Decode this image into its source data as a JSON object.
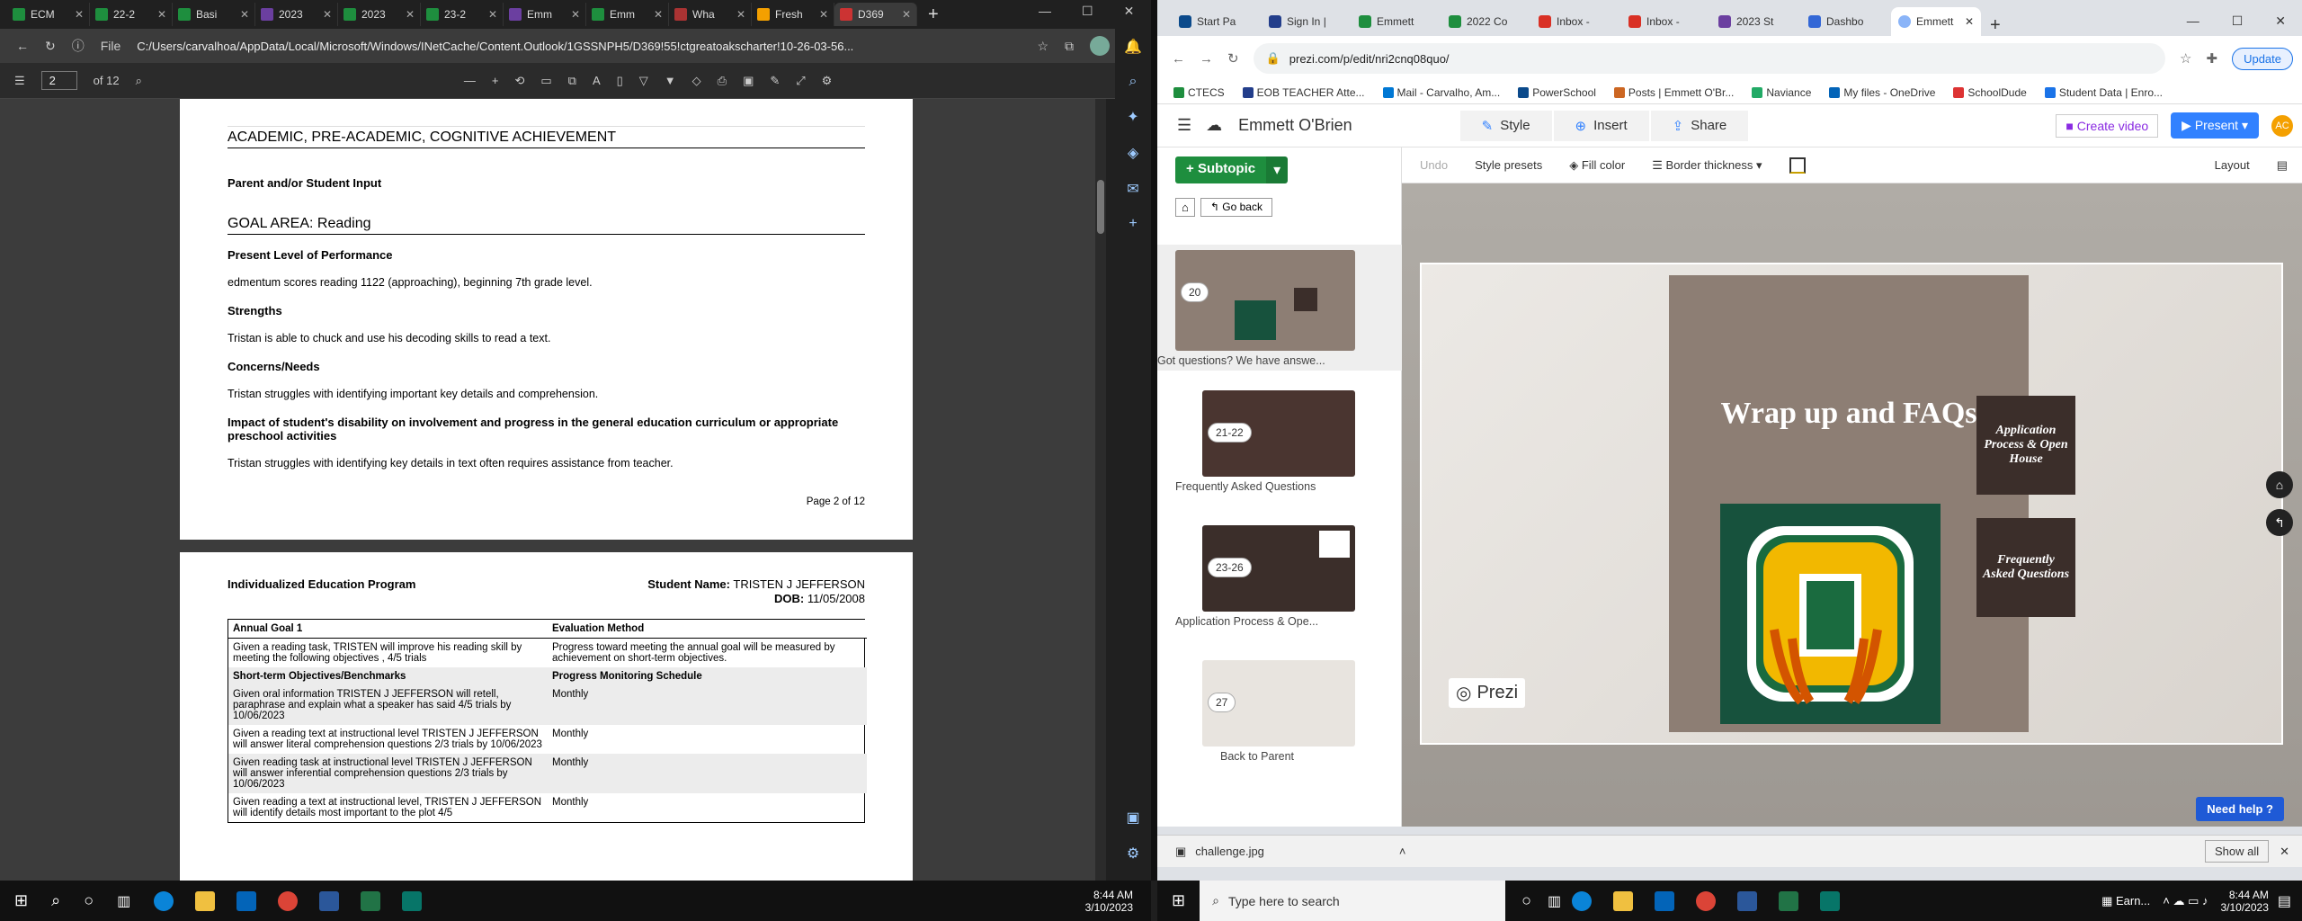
{
  "edge": {
    "tabs": [
      "ECM",
      "22-2",
      "Basi",
      "2023",
      "2023",
      "23-2",
      "Emm",
      "Emm",
      "Wha",
      "Fresh",
      "D369"
    ],
    "url": "C:/Users/carvalhoa/AppData/Local/Microsoft/Windows/INetCache/Content.Outlook/1GSSNPH5/D369!55!ctgreatoakscharter!10-26-03-56...",
    "file_label": "File",
    "page_num": "2",
    "page_total": "of 12"
  },
  "pdf": {
    "p1": {
      "section1": "ACADEMIC, PRE-ACADEMIC, COGNITIVE ACHIEVEMENT",
      "parent_input": "Parent and/or Student Input",
      "goal_area": "GOAL AREA: Reading",
      "plp_head": "Present Level of Performance",
      "plp_text": "edmentum scores reading 1122 (approaching), beginning 7th grade level.",
      "str_head": "Strengths",
      "str_text": "Tristan is able to chuck and use his decoding skills to read a text.",
      "con_head": "Concerns/Needs",
      "con_text": "Tristan struggles with identifying important key details and comprehension.",
      "imp_head": "Impact of student's disability on involvement and progress in the general education curriculum or appropriate preschool activities",
      "imp_text": "Tristan struggles with identifying key details in text often requires assistance from teacher.",
      "page_label": "Page 2 of 12"
    },
    "p2": {
      "title": "Individualized Education Program",
      "student_label": "Student Name:",
      "student_name": "TRISTEN J JEFFERSON",
      "dob_label": "DOB:",
      "dob": "11/05/2008",
      "goal_head": "Annual Goal  1",
      "eval_head": "Evaluation Method",
      "goal_text": "Given a reading task, TRISTEN will improve his reading skill by meeting the following objectives , 4/5 trials",
      "eval_text": "Progress toward meeting the annual goal will be measured by achievement on short-term objectives.",
      "obj_head": "Short-term Objectives/Benchmarks",
      "sched_head": "Progress Monitoring Schedule",
      "rows": [
        {
          "obj": "Given oral information TRISTEN J JEFFERSON will retell, paraphrase and explain what a speaker has said 4/5 trials by 10/06/2023",
          "sched": "Monthly"
        },
        {
          "obj": "Given a reading text at instructional level TRISTEN J JEFFERSON will answer literal comprehension questions 2/3 trials by 10/06/2023",
          "sched": "Monthly"
        },
        {
          "obj": "Given reading task at instructional level TRISTEN J JEFFERSON will answer inferential comprehension questions 2/3 trials by 10/06/2023",
          "sched": "Monthly"
        },
        {
          "obj": "Given reading a text at instructional level, TRISTEN J JEFFERSON will identify details most important to the plot 4/5",
          "sched": "Monthly"
        }
      ]
    }
  },
  "chrome": {
    "tabs": [
      "Start Pa",
      "Sign In |",
      "Emmett",
      "2022 Co",
      "Inbox -",
      "Inbox -",
      "2023 St",
      "Dashbo",
      "Emmett"
    ],
    "url": "prezi.com/p/edit/nri2cnq08quo/",
    "update": "Update",
    "bookmarks": [
      "CTECS",
      "EOB TEACHER Atte...",
      "Mail - Carvalho, Am...",
      "PowerSchool",
      "Posts | Emmett O'Br...",
      "Naviance",
      "My files - OneDrive",
      "SchoolDude",
      "Student Data | Enro..."
    ]
  },
  "prezi": {
    "title": "Emmett O'Brien",
    "style": "Style",
    "insert": "Insert",
    "share": "Share",
    "create_video": "Create video",
    "present": "Present",
    "avatar": "AC",
    "subtopic": "Subtopic",
    "go_back": "Go back",
    "undo": "Undo",
    "style_presets": "Style presets",
    "fill_color": "Fill color",
    "border_thickness": "Border thickness",
    "layout": "Layout",
    "thumbs": [
      {
        "num": "20",
        "label": "Got questions? We have answe..."
      },
      {
        "num": "21-22",
        "label": "Frequently Asked Questions"
      },
      {
        "num": "23-26",
        "label": "Application Process & Ope..."
      },
      {
        "num": "27",
        "label": "Back to Parent"
      }
    ],
    "slide_title": "Wrap up and FAQs",
    "card1": "Application Process & Open House",
    "card2": "Frequently Asked Questions",
    "logo": "Prezi",
    "need_help": "Need help",
    "download": "challenge.jpg",
    "show_all": "Show all"
  },
  "taskbar": {
    "time": "8:44 AM",
    "date": "3/10/2023",
    "search": "Type here to search",
    "earn": "Earn..."
  }
}
